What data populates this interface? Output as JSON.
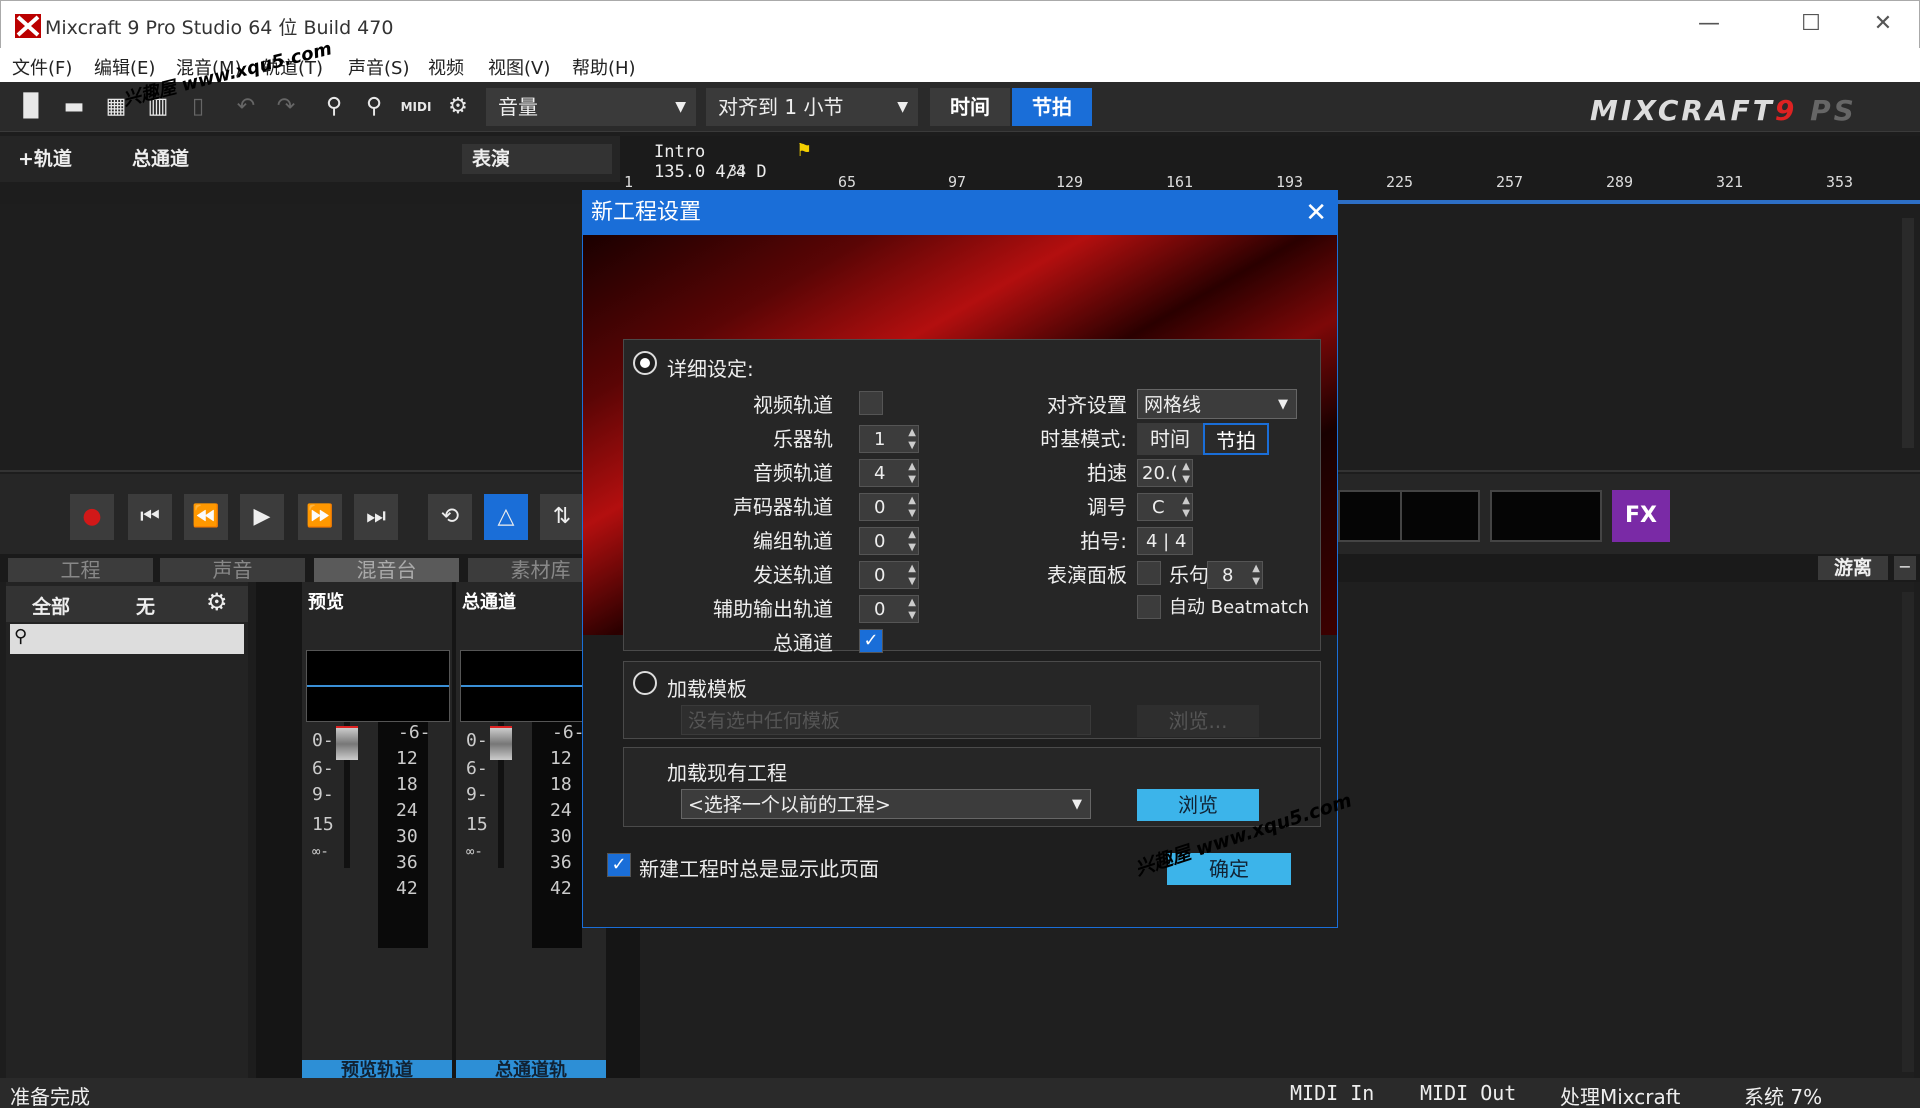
{
  "window": {
    "title": "Mixcraft 9 Pro Studio 64 位 Build 470",
    "minimize": "—",
    "maximize": "☐",
    "close": "✕"
  },
  "menu": [
    "文件(F)",
    "编辑(E)",
    "混音(M)",
    "轨道(T)",
    "声音(S)",
    "视频",
    "视图(V)",
    "帮助(H)"
  ],
  "watermark": "兴趣屋 www.xqu5.com",
  "toolbar": {
    "volume_dropdown": "音量",
    "snap_dropdown": "对齐到  1  小节",
    "time_button": "时间",
    "beat_button": "节拍",
    "brand_text": "MIXCRAFT",
    "brand_version": "9",
    "brand_suffix": "PS",
    "midi_label": "MIDI"
  },
  "track_header": {
    "add_track": "+轨道",
    "master_track": "总通道",
    "performance": "表演"
  },
  "timeline": {
    "marker_name": "Intro",
    "marker_info": "135.0  4/4  D",
    "ticks": [
      "1",
      "33",
      "65",
      "97",
      "129",
      "161",
      "193",
      "225",
      "257",
      "289",
      "321",
      "353"
    ]
  },
  "lower_tabs": [
    "工程",
    "声音",
    "混音台",
    "素材库"
  ],
  "detach_label": "游离",
  "sidebar": {
    "all": "全部",
    "none": "无"
  },
  "mixer": {
    "strips": [
      {
        "name": "预览",
        "footer": "预览轨道"
      },
      {
        "name": "总通道",
        "footer": "总通道轨"
      }
    ],
    "fader_scale": [
      "0-",
      "6-",
      "9-",
      "15",
      "∞-"
    ],
    "meter_scale": [
      "-6-",
      "12",
      "18",
      "24",
      "30",
      "36",
      "42"
    ]
  },
  "fx_button": "FX",
  "status": {
    "left": "准备完成",
    "midi_in": "MIDI In",
    "midi_out": "MIDI Out",
    "processing": "处理Mixcraft",
    "system": "系统 7%"
  },
  "dialog": {
    "title": "新工程设置",
    "close": "✕",
    "detailed": {
      "label": "详细设定:",
      "selected": true,
      "video_tracks": {
        "label": "视频轨道",
        "checked": false
      },
      "instrument_tracks": {
        "label": "乐器轨",
        "value": "1"
      },
      "audio_tracks": {
        "label": "音频轨道",
        "value": "4"
      },
      "vocoder_tracks": {
        "label": "声码器轨道",
        "value": "0"
      },
      "group_tracks": {
        "label": "编组轨道",
        "value": "0"
      },
      "send_tracks": {
        "label": "发送轨道",
        "value": "0"
      },
      "aux_tracks": {
        "label": "辅助输出轨道",
        "value": "0"
      },
      "master_track": {
        "label": "总通道",
        "checked": true
      },
      "snap_setting": {
        "label": "对齐设置",
        "value": "网格线"
      },
      "timebase": {
        "label": "时基模式:",
        "time": "时间",
        "beat": "节拍",
        "selected": "beat"
      },
      "tempo": {
        "label": "拍速",
        "value": "20.("
      },
      "key": {
        "label": "调号",
        "value": "C"
      },
      "time_sig": {
        "label": "拍号:",
        "num": "4",
        "den": "4"
      },
      "performance_panel": {
        "label": "表演面板",
        "checked": false
      },
      "phrase": {
        "label": "乐句",
        "value": "8"
      },
      "auto_beatmatch": {
        "label": "自动 Beatmatch",
        "checked": false
      }
    },
    "template": {
      "label": "加载模板",
      "placeholder": "没有选中任何模板",
      "browse": "浏览..."
    },
    "existing": {
      "label": "加载现有工程",
      "select": "<选择一个以前的工程>",
      "browse": "浏览"
    },
    "always_show": {
      "label": "新建工程时总是显示此页面",
      "checked": true
    },
    "ok": "确定"
  },
  "colors": {
    "accent": "#1a6ed8",
    "fx": "#7a2aa6",
    "record": "#d21818",
    "brand_red": "#d22222"
  }
}
